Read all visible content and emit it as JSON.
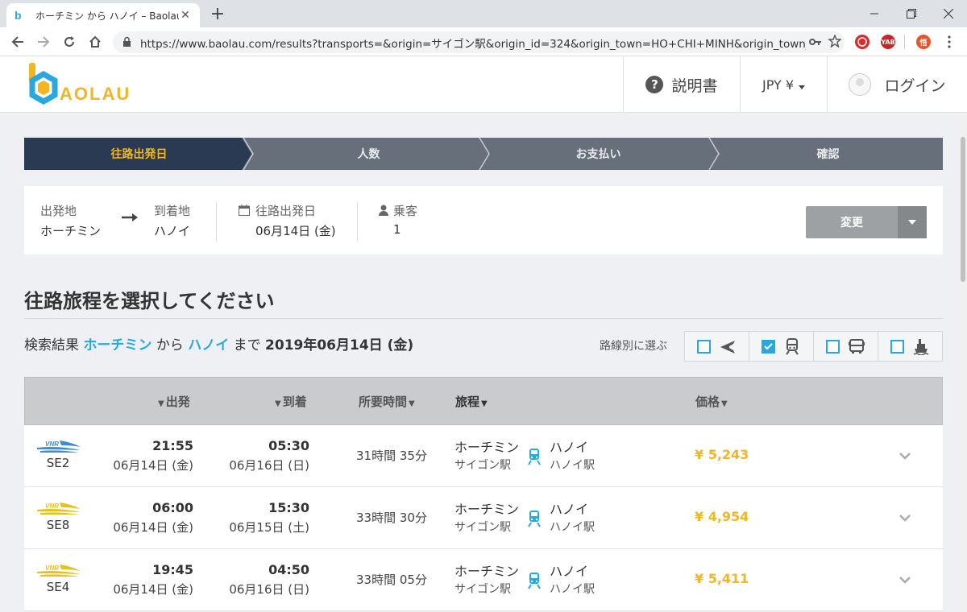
{
  "browser": {
    "tab_title": "ホーチミン から ハノイ – Baolau",
    "favicon": "b",
    "close_glyph": "✕",
    "newtab_glyph": "+",
    "url": "https://www.baolau.com/results?transports=&origin=サイゴン駅&origin_id=324&origin_town=HO+CHI+MINH&origin_town_lan...",
    "extensions": [
      "YAB",
      "悟"
    ]
  },
  "header": {
    "logo_text": "AOLAU",
    "help_label": "説明書",
    "currency_label": "JPY ¥",
    "login_label": "ログイン"
  },
  "stepper": {
    "steps": [
      {
        "label": "往路出発日",
        "active": true
      },
      {
        "label": "人数",
        "active": false
      },
      {
        "label": "お支払い",
        "active": false
      },
      {
        "label": "確認",
        "active": false
      }
    ]
  },
  "search": {
    "from_label": "出発地",
    "from_value": "ホーチミン",
    "to_label": "到着地",
    "to_value": "ハノイ",
    "date_label": "往路出発日",
    "date_value": "06月14日 (金)",
    "pax_label": "乗客",
    "pax_value": "1",
    "change_label": "変更"
  },
  "main": {
    "title": "往路旅程を選択してください",
    "results_prefix": "検索結果",
    "results_origin": "ホーチミン",
    "results_from": "から",
    "results_dest": "ハノイ",
    "results_to": "まで",
    "results_date": "2019年06月14日 (金)",
    "filter_label": "路線別に選ぶ",
    "filters": [
      {
        "mode": "plane-icon",
        "checked": false
      },
      {
        "mode": "train-icon",
        "checked": true
      },
      {
        "mode": "bus-icon",
        "checked": false
      },
      {
        "mode": "ferry-icon",
        "checked": false
      }
    ]
  },
  "table": {
    "columns": {
      "depart": "出発",
      "arrive": "到着",
      "duration": "所要時間",
      "itinerary": "旅程",
      "price": "価格"
    },
    "rows": [
      {
        "logo_color": "#3d8ed1",
        "train": "SE2",
        "dep_time": "21:55",
        "dep_date": "06月14日 (金)",
        "arr_time": "05:30",
        "arr_date": "06月16日 (日)",
        "duration": "31時間 35分",
        "from_city": "ホーチミン",
        "from_station": "サイゴン駅",
        "to_city": "ハノイ",
        "to_station": "ハノイ駅",
        "price": "¥ 5,243"
      },
      {
        "logo_color": "#e8c11e",
        "train": "SE8",
        "dep_time": "06:00",
        "dep_date": "06月14日 (金)",
        "arr_time": "15:30",
        "arr_date": "06月15日 (土)",
        "duration": "33時間 30分",
        "from_city": "ホーチミン",
        "from_station": "サイゴン駅",
        "to_city": "ハノイ",
        "to_station": "ハノイ駅",
        "price": "¥ 4,954"
      },
      {
        "logo_color": "#e8c11e",
        "train": "SE4",
        "dep_time": "19:45",
        "dep_date": "06月14日 (金)",
        "arr_time": "04:50",
        "arr_date": "06月16日 (日)",
        "duration": "33時間 05分",
        "from_city": "ホーチミン",
        "from_station": "サイゴン駅",
        "to_city": "ハノイ",
        "to_station": "ハノイ駅",
        "price": "¥ 5,411"
      }
    ]
  }
}
